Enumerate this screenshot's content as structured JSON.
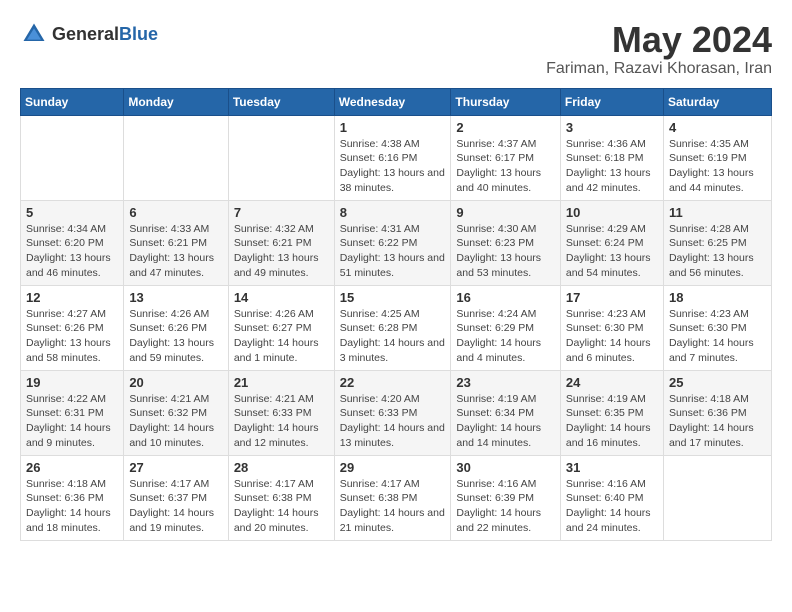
{
  "header": {
    "logo_general": "General",
    "logo_blue": "Blue",
    "title": "May 2024",
    "subtitle": "Fariman, Razavi Khorasan, Iran"
  },
  "calendar": {
    "weekdays": [
      "Sunday",
      "Monday",
      "Tuesday",
      "Wednesday",
      "Thursday",
      "Friday",
      "Saturday"
    ],
    "weeks": [
      [
        {
          "day": "",
          "sunrise": "",
          "sunset": "",
          "daylight": ""
        },
        {
          "day": "",
          "sunrise": "",
          "sunset": "",
          "daylight": ""
        },
        {
          "day": "",
          "sunrise": "",
          "sunset": "",
          "daylight": ""
        },
        {
          "day": "1",
          "sunrise": "Sunrise: 4:38 AM",
          "sunset": "Sunset: 6:16 PM",
          "daylight": "Daylight: 13 hours and 38 minutes."
        },
        {
          "day": "2",
          "sunrise": "Sunrise: 4:37 AM",
          "sunset": "Sunset: 6:17 PM",
          "daylight": "Daylight: 13 hours and 40 minutes."
        },
        {
          "day": "3",
          "sunrise": "Sunrise: 4:36 AM",
          "sunset": "Sunset: 6:18 PM",
          "daylight": "Daylight: 13 hours and 42 minutes."
        },
        {
          "day": "4",
          "sunrise": "Sunrise: 4:35 AM",
          "sunset": "Sunset: 6:19 PM",
          "daylight": "Daylight: 13 hours and 44 minutes."
        }
      ],
      [
        {
          "day": "5",
          "sunrise": "Sunrise: 4:34 AM",
          "sunset": "Sunset: 6:20 PM",
          "daylight": "Daylight: 13 hours and 46 minutes."
        },
        {
          "day": "6",
          "sunrise": "Sunrise: 4:33 AM",
          "sunset": "Sunset: 6:21 PM",
          "daylight": "Daylight: 13 hours and 47 minutes."
        },
        {
          "day": "7",
          "sunrise": "Sunrise: 4:32 AM",
          "sunset": "Sunset: 6:21 PM",
          "daylight": "Daylight: 13 hours and 49 minutes."
        },
        {
          "day": "8",
          "sunrise": "Sunrise: 4:31 AM",
          "sunset": "Sunset: 6:22 PM",
          "daylight": "Daylight: 13 hours and 51 minutes."
        },
        {
          "day": "9",
          "sunrise": "Sunrise: 4:30 AM",
          "sunset": "Sunset: 6:23 PM",
          "daylight": "Daylight: 13 hours and 53 minutes."
        },
        {
          "day": "10",
          "sunrise": "Sunrise: 4:29 AM",
          "sunset": "Sunset: 6:24 PM",
          "daylight": "Daylight: 13 hours and 54 minutes."
        },
        {
          "day": "11",
          "sunrise": "Sunrise: 4:28 AM",
          "sunset": "Sunset: 6:25 PM",
          "daylight": "Daylight: 13 hours and 56 minutes."
        }
      ],
      [
        {
          "day": "12",
          "sunrise": "Sunrise: 4:27 AM",
          "sunset": "Sunset: 6:26 PM",
          "daylight": "Daylight: 13 hours and 58 minutes."
        },
        {
          "day": "13",
          "sunrise": "Sunrise: 4:26 AM",
          "sunset": "Sunset: 6:26 PM",
          "daylight": "Daylight: 13 hours and 59 minutes."
        },
        {
          "day": "14",
          "sunrise": "Sunrise: 4:26 AM",
          "sunset": "Sunset: 6:27 PM",
          "daylight": "Daylight: 14 hours and 1 minute."
        },
        {
          "day": "15",
          "sunrise": "Sunrise: 4:25 AM",
          "sunset": "Sunset: 6:28 PM",
          "daylight": "Daylight: 14 hours and 3 minutes."
        },
        {
          "day": "16",
          "sunrise": "Sunrise: 4:24 AM",
          "sunset": "Sunset: 6:29 PM",
          "daylight": "Daylight: 14 hours and 4 minutes."
        },
        {
          "day": "17",
          "sunrise": "Sunrise: 4:23 AM",
          "sunset": "Sunset: 6:30 PM",
          "daylight": "Daylight: 14 hours and 6 minutes."
        },
        {
          "day": "18",
          "sunrise": "Sunrise: 4:23 AM",
          "sunset": "Sunset: 6:30 PM",
          "daylight": "Daylight: 14 hours and 7 minutes."
        }
      ],
      [
        {
          "day": "19",
          "sunrise": "Sunrise: 4:22 AM",
          "sunset": "Sunset: 6:31 PM",
          "daylight": "Daylight: 14 hours and 9 minutes."
        },
        {
          "day": "20",
          "sunrise": "Sunrise: 4:21 AM",
          "sunset": "Sunset: 6:32 PM",
          "daylight": "Daylight: 14 hours and 10 minutes."
        },
        {
          "day": "21",
          "sunrise": "Sunrise: 4:21 AM",
          "sunset": "Sunset: 6:33 PM",
          "daylight": "Daylight: 14 hours and 12 minutes."
        },
        {
          "day": "22",
          "sunrise": "Sunrise: 4:20 AM",
          "sunset": "Sunset: 6:33 PM",
          "daylight": "Daylight: 14 hours and 13 minutes."
        },
        {
          "day": "23",
          "sunrise": "Sunrise: 4:19 AM",
          "sunset": "Sunset: 6:34 PM",
          "daylight": "Daylight: 14 hours and 14 minutes."
        },
        {
          "day": "24",
          "sunrise": "Sunrise: 4:19 AM",
          "sunset": "Sunset: 6:35 PM",
          "daylight": "Daylight: 14 hours and 16 minutes."
        },
        {
          "day": "25",
          "sunrise": "Sunrise: 4:18 AM",
          "sunset": "Sunset: 6:36 PM",
          "daylight": "Daylight: 14 hours and 17 minutes."
        }
      ],
      [
        {
          "day": "26",
          "sunrise": "Sunrise: 4:18 AM",
          "sunset": "Sunset: 6:36 PM",
          "daylight": "Daylight: 14 hours and 18 minutes."
        },
        {
          "day": "27",
          "sunrise": "Sunrise: 4:17 AM",
          "sunset": "Sunset: 6:37 PM",
          "daylight": "Daylight: 14 hours and 19 minutes."
        },
        {
          "day": "28",
          "sunrise": "Sunrise: 4:17 AM",
          "sunset": "Sunset: 6:38 PM",
          "daylight": "Daylight: 14 hours and 20 minutes."
        },
        {
          "day": "29",
          "sunrise": "Sunrise: 4:17 AM",
          "sunset": "Sunset: 6:38 PM",
          "daylight": "Daylight: 14 hours and 21 minutes."
        },
        {
          "day": "30",
          "sunrise": "Sunrise: 4:16 AM",
          "sunset": "Sunset: 6:39 PM",
          "daylight": "Daylight: 14 hours and 22 minutes."
        },
        {
          "day": "31",
          "sunrise": "Sunrise: 4:16 AM",
          "sunset": "Sunset: 6:40 PM",
          "daylight": "Daylight: 14 hours and 24 minutes."
        },
        {
          "day": "",
          "sunrise": "",
          "sunset": "",
          "daylight": ""
        }
      ]
    ]
  }
}
